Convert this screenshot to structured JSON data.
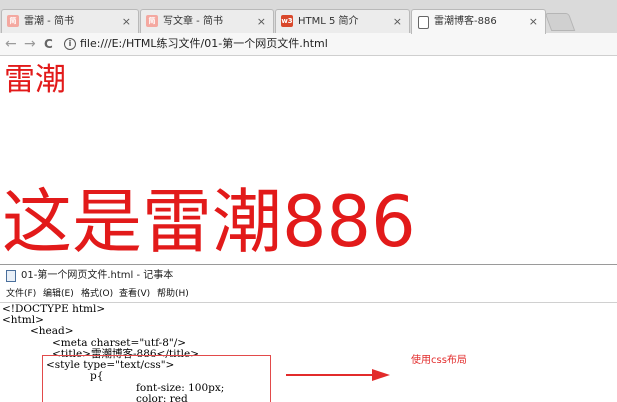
{
  "browser": {
    "tabs": [
      {
        "title": "雷潮 - 简书",
        "favicon": "jianshu-icon",
        "favicon_text": "简",
        "favicon_color": "#f4a8a0",
        "active": false
      },
      {
        "title": "写文章 - 简书",
        "favicon": "jianshu-icon",
        "favicon_text": "简",
        "favicon_color": "#f4a8a0",
        "active": false
      },
      {
        "title": "HTML 5 简介",
        "favicon": "w3school-icon",
        "favicon_text": "w3",
        "favicon_color": "#d9482b",
        "active": false
      },
      {
        "title": "雷潮博客-886",
        "favicon": "document-icon",
        "favicon_text": "",
        "favicon_color": "#ffffff",
        "active": true
      }
    ],
    "tab_close_glyph": "×",
    "address": "file:///E:/HTML练习文件/01-第一个网页文件.html",
    "back_glyph": "←",
    "forward_glyph": "→",
    "reload_glyph": "C",
    "info_glyph": "i"
  },
  "page": {
    "heading_small": "雷潮",
    "heading_big": "这是雷潮886",
    "text_color": "#e21a1a"
  },
  "notepad": {
    "title": "01-第一个网页文件.html - 记事本",
    "menu": [
      "文件(F)",
      "编辑(E)",
      "格式(O)",
      "查看(V)",
      "帮助(H)"
    ],
    "code_lines": [
      "<!DOCTYPE html>",
      "<html>",
      "<head>",
      "<meta charset=\"utf-8\"/>",
      "<title>雷潮博客-886</title>",
      "<style type=\"text/css\">",
      "p{",
      "font-size: 100px;",
      "color: red"
    ],
    "annotation": "使用css布局",
    "annotation_color": "#e22b2b"
  }
}
